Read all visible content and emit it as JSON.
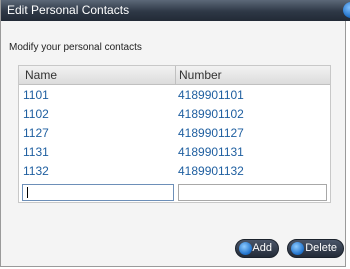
{
  "window": {
    "title": "Edit Personal Contacts"
  },
  "subtitle": "Modify your personal contacts",
  "table": {
    "columns": [
      "Name",
      "Number"
    ],
    "rows": [
      {
        "name": "1101",
        "number": "4189901101"
      },
      {
        "name": "1102",
        "number": "4189901102"
      },
      {
        "name": "1127",
        "number": "4189901127"
      },
      {
        "name": "1131",
        "number": "4189901131"
      },
      {
        "name": "1132",
        "number": "4189901132"
      }
    ],
    "new_name_value": "",
    "new_number_value": ""
  },
  "buttons": {
    "add_label": "Add",
    "delete_label": "Delete"
  },
  "colors": {
    "titlebar": "#2e3846",
    "link_text": "#1f5fa0",
    "button_icon": "#1c6fc9"
  },
  "icons": {
    "title_icon": "circle-icon",
    "add_icon": "circle-icon",
    "delete_icon": "circle-icon"
  }
}
